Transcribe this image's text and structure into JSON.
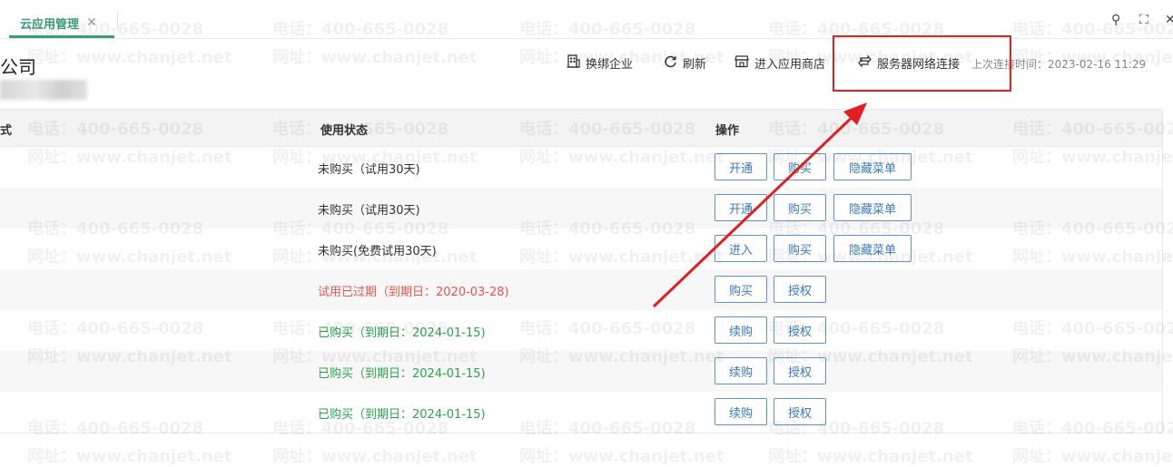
{
  "tabs": {
    "active_label": "云应用管理",
    "close_glyph": "✕"
  },
  "window_controls": {
    "search_icon": "⚲",
    "expand_icon": "⛶",
    "close_icon": "✕"
  },
  "header": {
    "company_name": "公司"
  },
  "toolbar": {
    "switch_company": "换绑企业",
    "refresh": "刷新",
    "enter_store": "进入应用商店",
    "server_connection": "服务器网络连接",
    "last_connection": "上次连接时间：2023-02-16 11:29"
  },
  "table": {
    "headers": {
      "mode": "式",
      "status": "使用状态",
      "actions": "操作"
    },
    "rows": [
      {
        "status": "未购买（试用30天)",
        "status_type": "normal",
        "buttons": [
          "开通",
          "购买",
          "隐藏菜单"
        ]
      },
      {
        "status": "未购买（试用30天)",
        "status_type": "normal",
        "buttons": [
          "开通",
          "购买",
          "隐藏菜单"
        ]
      },
      {
        "status": "未购买(免费试用30天)",
        "status_type": "normal",
        "buttons": [
          "进入",
          "购买",
          "隐藏菜单"
        ]
      },
      {
        "status": "试用已过期（到期日：2020-03-28)",
        "status_type": "expired",
        "buttons": [
          "购买",
          "授权"
        ]
      },
      {
        "status": "已购买（到期日：2024-01-15)",
        "status_type": "bought",
        "buttons": [
          "续购",
          "授权"
        ]
      },
      {
        "status": "已购买（到期日：2024-01-15)",
        "status_type": "bought",
        "buttons": [
          "续购",
          "授权"
        ]
      },
      {
        "status": "已购买（到期日：2024-01-15)",
        "status_type": "bought",
        "buttons": [
          "续购",
          "授权"
        ]
      }
    ]
  },
  "watermark": {
    "phone": "电话：400-665-0028",
    "site": "网址：www.chanjet.net"
  },
  "colors": {
    "accent": "#3a9c78",
    "expired": "#e8534c",
    "bought": "#2aa34a",
    "button": "#3a78c2",
    "annotation": "#e02020"
  }
}
